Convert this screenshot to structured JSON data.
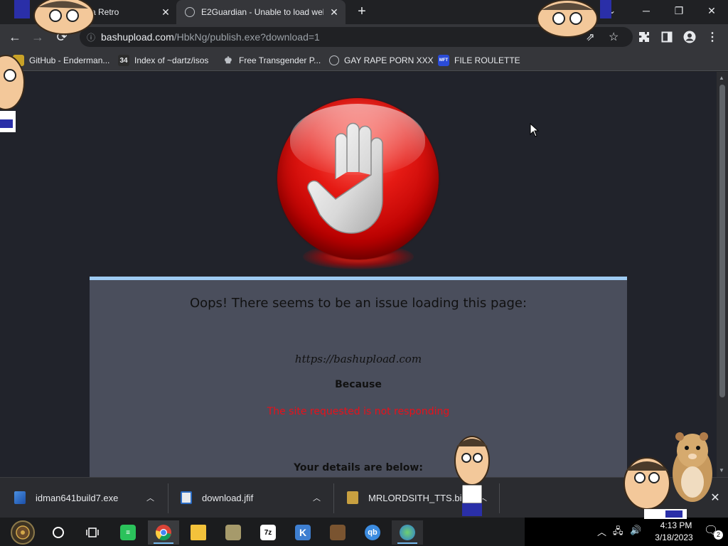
{
  "browser": {
    "tabs": [
      {
        "title": "a Retro",
        "active": false
      },
      {
        "title": "E2Guardian - Unable to load web",
        "active": true
      }
    ],
    "new_tab_label": "+",
    "window_controls": {
      "minimize": "─",
      "restore": "❐",
      "close": "✕"
    },
    "url": {
      "host": "bashupload.com",
      "path": "/HbkNg/publish.exe?download=1"
    }
  },
  "bookmarks": [
    {
      "label": "GitHub - Enderman...",
      "icon": "github-icon"
    },
    {
      "label": "Index of ~dartz/isos",
      "icon": "34-icon",
      "icon_text": "34"
    },
    {
      "label": "Free Transgender P...",
      "icon": "mask-icon"
    },
    {
      "label": "GAY RAPE PORN XXX",
      "icon": "globe-icon"
    },
    {
      "label": "FILE ROULETTE",
      "icon": "mft-icon",
      "icon_text": "MFT"
    }
  ],
  "page": {
    "heading": "Oops! There seems to be an issue loading this page:",
    "url": "https://bashupload.com",
    "because": "Because",
    "reason": "The site requested is not responding",
    "details": "Your details are below:"
  },
  "downloads": [
    {
      "filename": "idman641build7.exe",
      "icon": "exe-icon"
    },
    {
      "filename": "download.jfif",
      "icon": "image-file-icon"
    },
    {
      "filename": "MRLORDSITH_TTS.bin",
      "icon": "bin-file-icon"
    }
  ],
  "taskbar": {
    "clock_time": "4:13 PM",
    "clock_date": "3/18/2023",
    "notification_count": "2",
    "apps": [
      "start-button",
      "cortana-button",
      "task-view-button",
      "app-green",
      "chrome",
      "file-explorer",
      "app-photo",
      "7zip",
      "app-k",
      "app-brown",
      "qbittorrent",
      "app-globe"
    ]
  },
  "colors": {
    "page_bg": "#21232b",
    "error_box_bg": "#4a4e5c",
    "error_box_border": "#9ecbf3",
    "reason_red": "#e8101a",
    "stop_red": "#e51a14"
  }
}
